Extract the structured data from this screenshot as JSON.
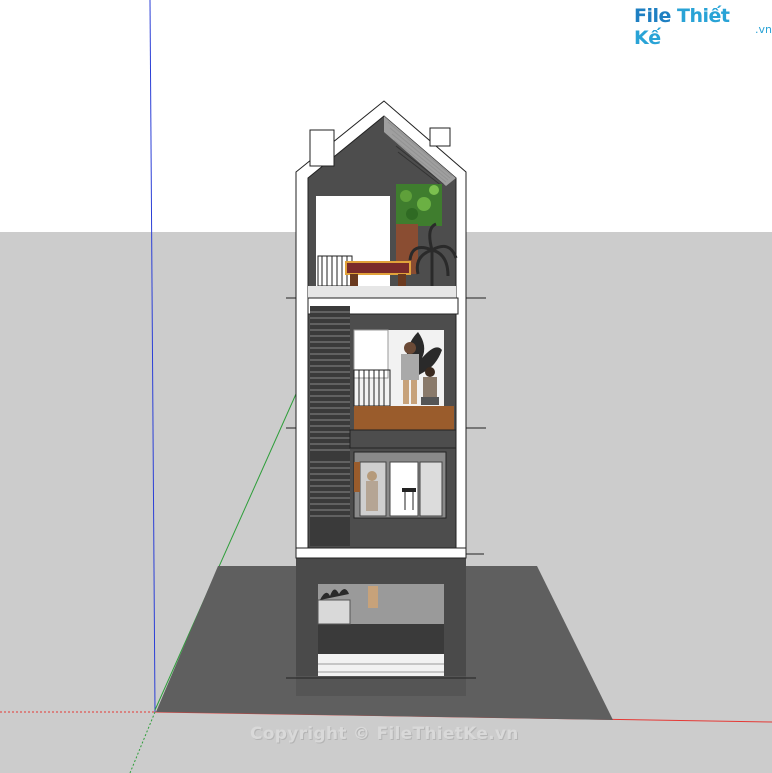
{
  "watermark": {
    "logo_prefix": "File",
    "logo_name": "Thiết Kế",
    "logo_domain": ".vn",
    "copyright": "Copyright © FileThietKe.vn"
  },
  "colors": {
    "sky": "#ffffff",
    "ground": "#cccccc",
    "wall_white": "#ffffff",
    "wall_dark": "#555555",
    "shadow": "#5f5f5f",
    "axis_red": "#e53935",
    "axis_green": "#2e9e3a",
    "axis_blue": "#2b3fd6",
    "wood": "#9a5c2c"
  }
}
